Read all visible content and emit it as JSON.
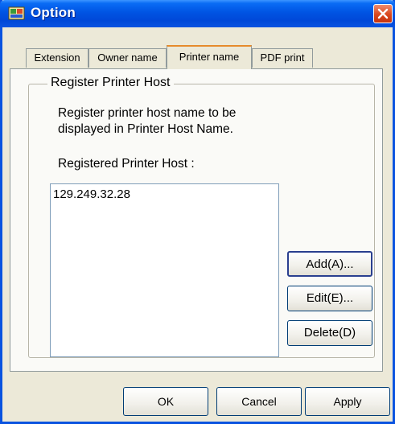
{
  "window": {
    "title": "Option"
  },
  "tabs": [
    {
      "label": "Extension",
      "active": false
    },
    {
      "label": "Owner name",
      "active": false
    },
    {
      "label": "Printer name",
      "active": true
    },
    {
      "label": "PDF print",
      "active": false
    }
  ],
  "group": {
    "title": "Register Printer Host",
    "description_line1": "Register printer host name to be",
    "description_line2": "displayed in Printer Host Name.",
    "list_label": "Registered Printer Host :",
    "items": [
      "129.249.32.28"
    ]
  },
  "side_buttons": {
    "add": "Add(A)...",
    "edit": "Edit(E)...",
    "delete": "Delete(D)"
  },
  "dialog_buttons": {
    "ok": "OK",
    "cancel": "Cancel",
    "apply": "Apply"
  },
  "colors": {
    "titlebar": "#0054e3",
    "dialog_bg": "#ece9d8",
    "tab_highlight": "#e68b2c",
    "close": "#d9481e"
  }
}
